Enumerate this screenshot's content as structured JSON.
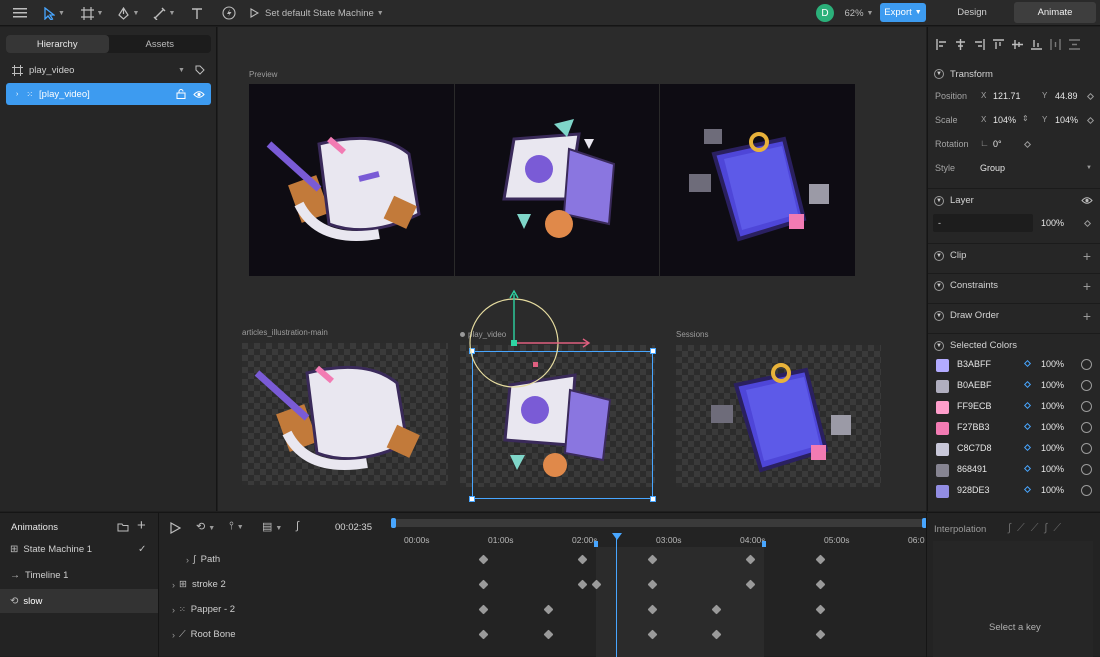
{
  "toolbar": {
    "state_machine_label": "Set default State Machine",
    "avatar_initial": "D",
    "zoom": "62%",
    "export_label": "Export",
    "mode_tabs": [
      "Design",
      "Animate"
    ],
    "active_mode": "Animate"
  },
  "left_panel": {
    "tabs": [
      "Hierarchy",
      "Assets"
    ],
    "root_item": "play_video",
    "selected_item": "[play_video]"
  },
  "canvas": {
    "preview_label": "Preview",
    "artboards": [
      "articles_illustration-main",
      "play_video",
      "Sessions"
    ]
  },
  "inspector": {
    "transform_title": "Transform",
    "position_label": "Position",
    "position_x": "121.71",
    "position_y": "44.89",
    "scale_label": "Scale",
    "scale_x": "104%",
    "scale_y": "104%",
    "rotation_label": "Rotation",
    "rotation_value": "0°",
    "style_label": "Style",
    "style_value": "Group",
    "x_label": "X",
    "y_label": "Y",
    "layer_title": "Layer",
    "layer_blend": "-",
    "layer_opacity": "100%",
    "clip_title": "Clip",
    "constraints_title": "Constraints",
    "draw_order_title": "Draw Order",
    "selected_colors_title": "Selected Colors",
    "colors": [
      {
        "hex": "B3ABFF",
        "pct": "100%",
        "color": "#B3ABFF"
      },
      {
        "hex": "B0AEBF",
        "pct": "100%",
        "color": "#B0AEBF"
      },
      {
        "hex": "FF9ECB",
        "pct": "100%",
        "color": "#FF9ECB"
      },
      {
        "hex": "F27BB3",
        "pct": "100%",
        "color": "#F27BB3"
      },
      {
        "hex": "C8C7D8",
        "pct": "100%",
        "color": "#C8C7D8"
      },
      {
        "hex": "868491",
        "pct": "100%",
        "color": "#868491"
      },
      {
        "hex": "928DE3",
        "pct": "100%",
        "color": "#928DE3"
      }
    ]
  },
  "animations": {
    "title": "Animations",
    "items": [
      "State Machine 1",
      "Timeline 1",
      "slow"
    ],
    "selected": "slow"
  },
  "timeline": {
    "time_display": "00:02:35",
    "ticks": [
      "00:00s",
      "01:00s",
      "02:00s",
      "03:00s",
      "04:00s",
      "05:00s",
      "06:0"
    ],
    "layers": [
      "Path",
      "stroke 2",
      "Papper - 2",
      "Root Bone"
    ],
    "interpolation_label": "Interpolation",
    "select_key_hint": "Select a key"
  },
  "colors": {
    "accent": "#48a6ff",
    "selected_row": "#3d9bf0",
    "avatar": "#2bb07a"
  }
}
